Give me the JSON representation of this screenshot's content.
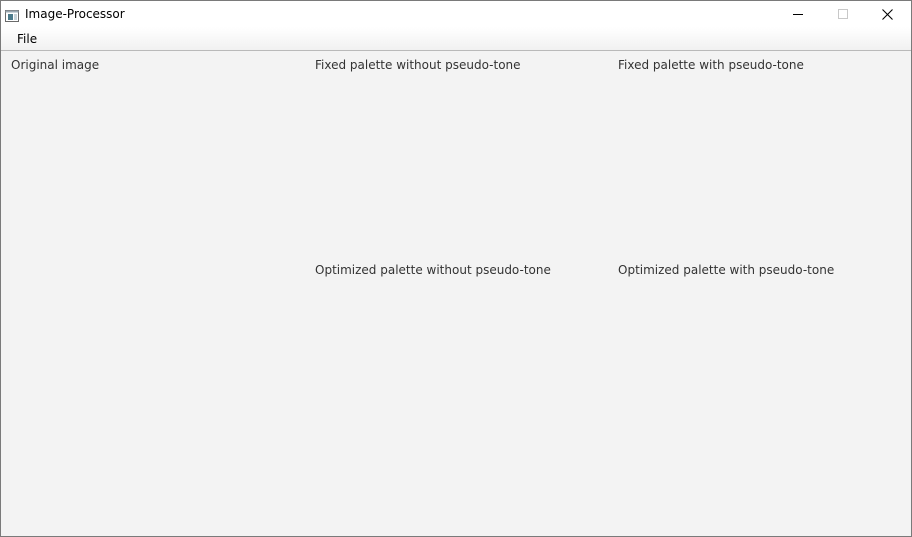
{
  "window": {
    "title": "Image-Processor",
    "icon": "app-window-icon",
    "controls": {
      "minimize_icon": "minimize-icon",
      "maximize_icon": "maximize-icon",
      "close_icon": "close-icon"
    }
  },
  "menu": {
    "items": [
      {
        "label": "File"
      }
    ]
  },
  "panels": {
    "original": {
      "label": "Original image"
    },
    "fixed_without": {
      "label": "Fixed palette without pseudo-tone"
    },
    "fixed_with": {
      "label": "Fixed palette with pseudo-tone"
    },
    "optimized_without": {
      "label": "Optimized palette without pseudo-tone"
    },
    "optimized_with": {
      "label": "Optimized palette with pseudo-tone"
    }
  },
  "colors": {
    "background": "#f3f3f3",
    "titlebar": "#ffffff",
    "label_text": "#333333"
  }
}
